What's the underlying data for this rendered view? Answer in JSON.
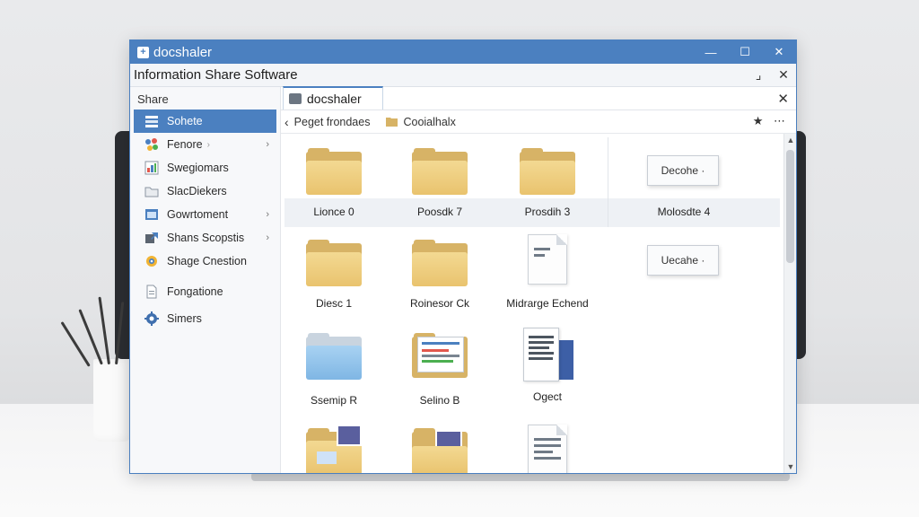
{
  "window": {
    "title": "docshaler",
    "controls": {
      "minimize": "—",
      "maximize": "☐",
      "close": "✕"
    }
  },
  "appbar": {
    "title": "Information Share Software",
    "restore": "⌟",
    "close": "✕"
  },
  "sidebar": {
    "header": "Share",
    "items": [
      {
        "label": "Sohete",
        "icon": "list-icon",
        "selected": true
      },
      {
        "label": "Fenore",
        "icon": "share-nodes-icon",
        "chevron": "›"
      },
      {
        "label": "Swegiomars",
        "icon": "chart-icon"
      },
      {
        "label": "SlacDiekers",
        "icon": "folder-outline-icon"
      },
      {
        "label": "Gowrtoment",
        "icon": "window-icon",
        "chevron": "›"
      },
      {
        "label": "Shans Scopstis",
        "icon": "share-icon",
        "chevron": "›"
      },
      {
        "label": "Shage Cnestion",
        "icon": "gear-icon"
      },
      {
        "label": "Fongatione",
        "icon": "document-icon"
      },
      {
        "label": "Simers",
        "icon": "settings-icon"
      }
    ]
  },
  "tab": {
    "label": "docshaler",
    "close": "✕"
  },
  "breadcrumb": {
    "back": "‹",
    "items": [
      "Peget frondaes",
      "Cooialhalx"
    ],
    "actions": "★ ⋯"
  },
  "grid": {
    "items": [
      {
        "label": "Lionce 0",
        "type": "folder"
      },
      {
        "label": "Poosdk 7",
        "type": "folder"
      },
      {
        "label": "Prosdih 3",
        "type": "folder"
      },
      {
        "label": "Molosdte 4",
        "type": "dropdown",
        "button": "Decohe ·"
      },
      {
        "label": "Diesc 1",
        "type": "folder"
      },
      {
        "label": "Roinesor Ck",
        "type": "folder"
      },
      {
        "label": "Midrarge Echend",
        "type": "document"
      },
      {
        "label": "",
        "type": "dropdown",
        "button": "Uecahe ·"
      },
      {
        "label": "Ssemip R",
        "type": "folder-blue"
      },
      {
        "label": "Selino B",
        "type": "folder-docs"
      },
      {
        "label": "Ogect",
        "type": "document-stack"
      },
      {
        "label": "",
        "type": "folder-image"
      },
      {
        "label": "",
        "type": "folder-image"
      },
      {
        "label": "",
        "type": "document"
      }
    ]
  },
  "scroll": {
    "up": "▲",
    "down": "▼"
  }
}
